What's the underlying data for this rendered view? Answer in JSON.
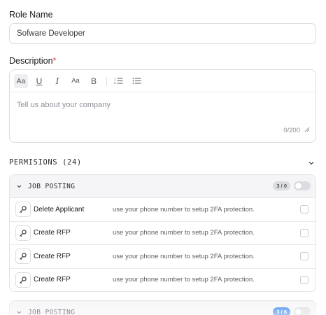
{
  "role_name": {
    "label": "Role Name",
    "value": "Sofware Developer"
  },
  "description": {
    "label": "Description",
    "required_mark": "*",
    "toolbar": [
      {
        "name": "text-style-icon",
        "glyph": "Aa"
      },
      {
        "name": "underline-icon",
        "glyph": "U"
      },
      {
        "name": "italic-icon",
        "glyph": "I"
      },
      {
        "name": "font-size-icon",
        "glyph": "Aa"
      },
      {
        "name": "bold-icon",
        "glyph": "B"
      },
      {
        "name": "ordered-list-icon",
        "glyph": "1≡"
      },
      {
        "name": "bullet-list-icon",
        "glyph": "☰"
      }
    ],
    "placeholder": "Tell us about your company",
    "counter": "0/200"
  },
  "permissions": {
    "title": "PERMISIONS (24)",
    "groups": [
      {
        "title": "JOB POSTING",
        "badge": "3 / 0",
        "badge_color": "#dcdde1",
        "enabled": false,
        "rows": [
          {
            "name": "Delete Applicant",
            "description": "use your phone number to setup 2FA protection.",
            "checked": false
          },
          {
            "name": "Create RFP",
            "description": "use your phone number to setup 2FA protection.",
            "checked": false
          },
          {
            "name": "Create RFP",
            "description": "use your phone number to setup 2FA protection.",
            "checked": false
          },
          {
            "name": "Create RFP",
            "description": "use your phone number to setup 2FA protection.",
            "checked": false
          }
        ]
      },
      {
        "title": "JOB POSTING",
        "badge": "3 / 6",
        "badge_color": "#2f80ed",
        "enabled": false,
        "rows": []
      }
    ]
  },
  "colors": {
    "accent": "#2f80ed",
    "required": "#e5484d",
    "border": "#dcdde1"
  }
}
